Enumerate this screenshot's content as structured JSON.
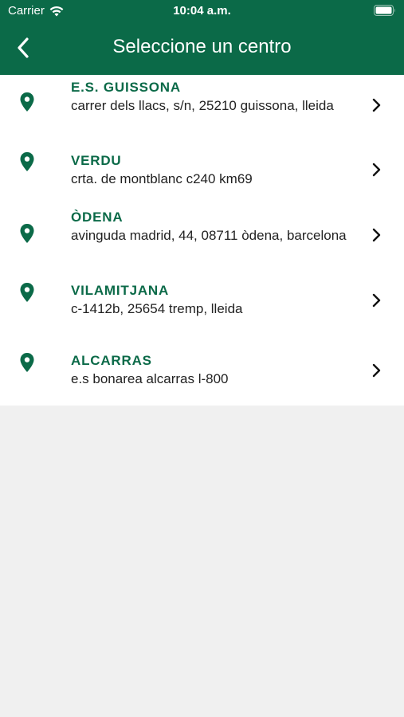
{
  "status_bar": {
    "carrier": "Carrier",
    "time": "10:04 a.m."
  },
  "nav": {
    "title": "Seleccione un centro",
    "back_icon": "chevron-left-icon"
  },
  "colors": {
    "brand_green": "#0b6a48",
    "list_background": "#ffffff",
    "page_background": "#f0f0f0"
  },
  "centers": [
    {
      "name": "E.S. GUISSONA",
      "address": "carrer dels llacs, s/n, 25210 guissona, lleida"
    },
    {
      "name": "VERDU",
      "address": "crta. de montblanc c240 km69"
    },
    {
      "name": "ÒDENA",
      "address": "avinguda madrid, 44, 08711 òdena, barcelona"
    },
    {
      "name": "VILAMITJANA",
      "address": "c-1412b, 25654 tremp, lleida"
    },
    {
      "name": "ALCARRAS",
      "address": "e.s bonarea alcarras l-800"
    }
  ]
}
